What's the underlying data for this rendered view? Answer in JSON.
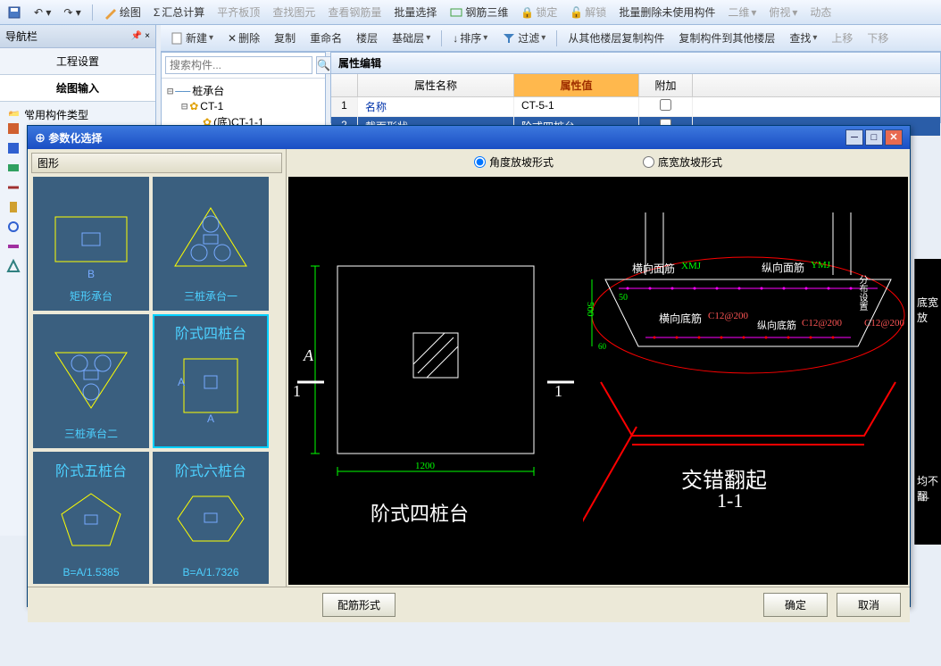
{
  "toolbar": {
    "drawing": "绘图",
    "summary": "汇总计算",
    "flatten": "平齐板顶",
    "find_elem": "查找图元",
    "rebar_qty": "查看钢筋量",
    "batch_sel": "批量选择",
    "rebar_3d": "钢筋三维",
    "lock": "锁定",
    "unlock": "解锁",
    "batch_del": "批量删除未使用构件",
    "view_2d": "二维",
    "view_persp": "俯视",
    "dynamic": "动态"
  },
  "subtoolbar": {
    "new": "新建",
    "delete": "删除",
    "copy": "复制",
    "rename": "重命名",
    "floor": "楼层",
    "foundation": "基础层",
    "sort": "排序",
    "filter": "过滤",
    "copy_from": "从其他楼层复制构件",
    "copy_to": "复制构件到其他楼层",
    "find": "查找",
    "move_up": "上移",
    "move_down": "下移"
  },
  "nav": {
    "title": "导航栏",
    "proj_settings": "工程设置",
    "drawing_input": "绘图输入",
    "common_types": "常用构件类型"
  },
  "tree": {
    "search_placeholder": "搜索构件...",
    "root": "桩承台",
    "child": "CT-1",
    "grandchild": "(底)CT-1-1"
  },
  "prop": {
    "panel_title": "属性编辑",
    "h_name": "属性名称",
    "h_val": "属性值",
    "h_add": "附加",
    "rows": [
      {
        "idx": "1",
        "name": "名称",
        "val": "CT-5-1"
      },
      {
        "idx": "2",
        "name": "截面形状",
        "val": "阶式四桩台"
      }
    ]
  },
  "modal": {
    "title": "参数化选择",
    "shape_label": "图形",
    "shapes": [
      {
        "label": "矩形承台"
      },
      {
        "label": "三桩承台一"
      },
      {
        "label": "三桩承台二"
      },
      {
        "label_top": "阶式四桩台"
      },
      {
        "label_top": "阶式五桩台",
        "label_bot": "B=A/1.5385"
      },
      {
        "label_top": "阶式六桩台",
        "label_bot": "B=A/1.7326"
      }
    ],
    "radio_angle": "角度放坡形式",
    "radio_width": "底宽放坡形式",
    "btn_rebar": "配筋形式",
    "btn_ok": "确定",
    "btn_cancel": "取消"
  },
  "cad": {
    "plan_title": "阶式四桩台",
    "plan_dim": "1200",
    "section_title1": "交错翻起",
    "section_title2": "1-1",
    "dim_a": "A",
    "dim_1": "1",
    "label_hxmj": "横向面筋",
    "label_xmj": "XMJ",
    "label_zxmj": "纵向面筋",
    "label_ymj": "YMJ",
    "label_hxdj": "横向底筋",
    "label_zxdj": "纵向底筋",
    "label_c12": "C12@200",
    "label_500": "500",
    "label_60": "60",
    "label_50": "50",
    "label_fbsz": "分布设置"
  },
  "right_cut": {
    "top_label": "底宽放",
    "mid_label": "均不翻",
    "bot_label": "1-"
  }
}
